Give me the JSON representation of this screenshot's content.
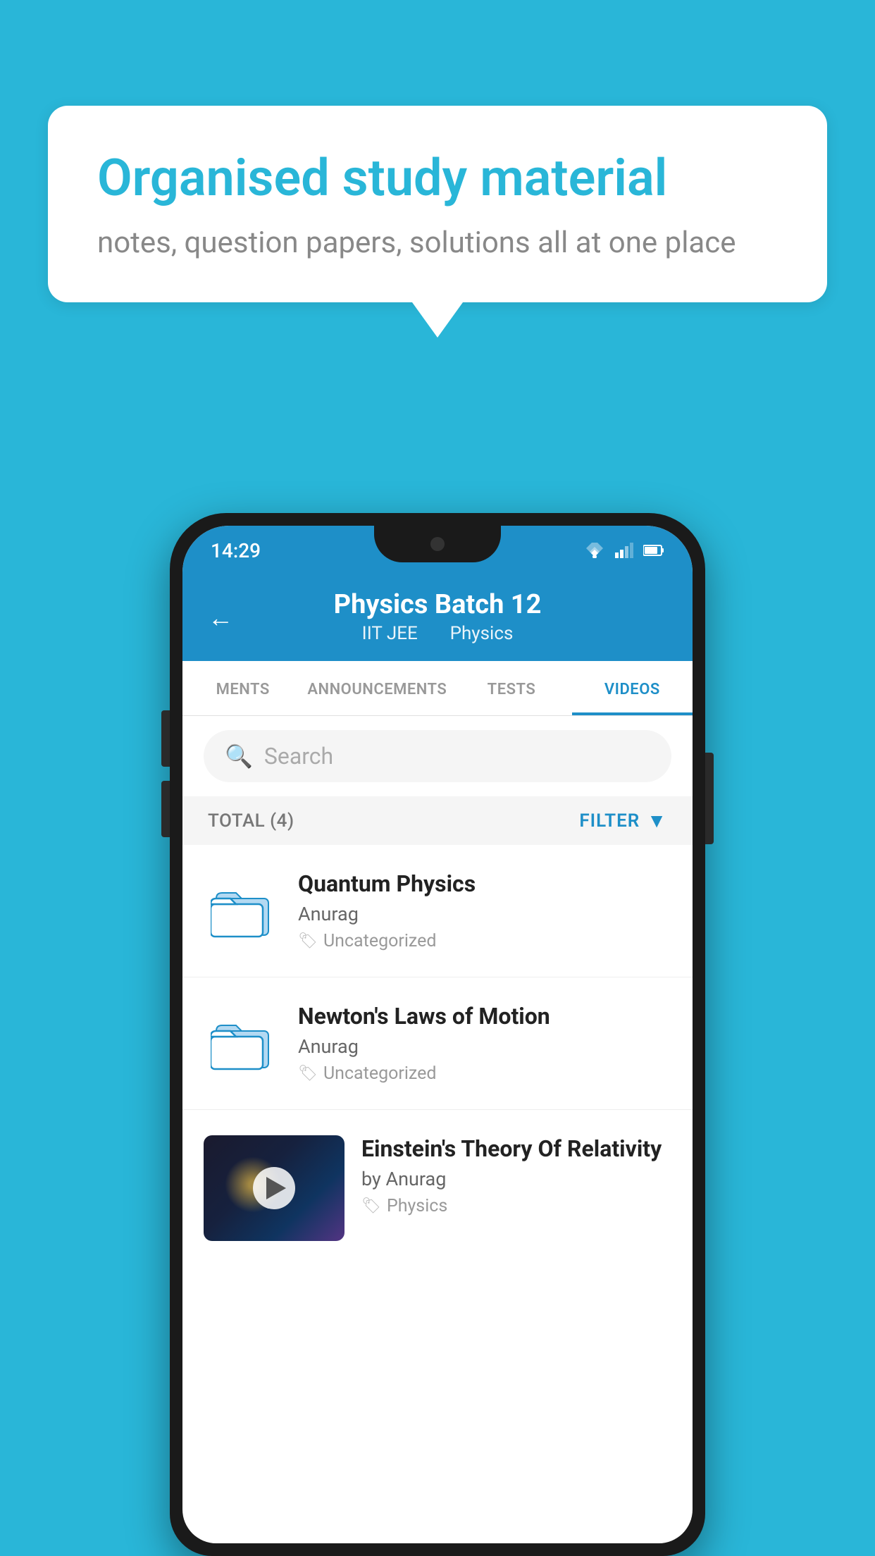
{
  "bubble": {
    "headline": "Organised study material",
    "subtext": "notes, question papers, solutions all at one place"
  },
  "statusBar": {
    "time": "14:29"
  },
  "header": {
    "back_label": "←",
    "title": "Physics Batch 12",
    "subtitle_left": "IIT JEE",
    "subtitle_right": "Physics"
  },
  "tabs": [
    {
      "label": "MENTS",
      "active": false
    },
    {
      "label": "ANNOUNCEMENTS",
      "active": false
    },
    {
      "label": "TESTS",
      "active": false
    },
    {
      "label": "VIDEOS",
      "active": true
    }
  ],
  "search": {
    "placeholder": "Search"
  },
  "filterBar": {
    "total_label": "TOTAL (4)",
    "filter_label": "FILTER"
  },
  "videos": [
    {
      "title": "Quantum Physics",
      "author": "Anurag",
      "tag": "Uncategorized",
      "type": "folder",
      "has_thumbnail": false
    },
    {
      "title": "Newton's Laws of Motion",
      "author": "Anurag",
      "tag": "Uncategorized",
      "type": "folder",
      "has_thumbnail": false
    },
    {
      "title": "Einstein's Theory Of Relativity",
      "author": "by Anurag",
      "tag": "Physics",
      "type": "video",
      "has_thumbnail": true
    }
  ],
  "colors": {
    "primary": "#1e8fc8",
    "background": "#29b6d8"
  }
}
